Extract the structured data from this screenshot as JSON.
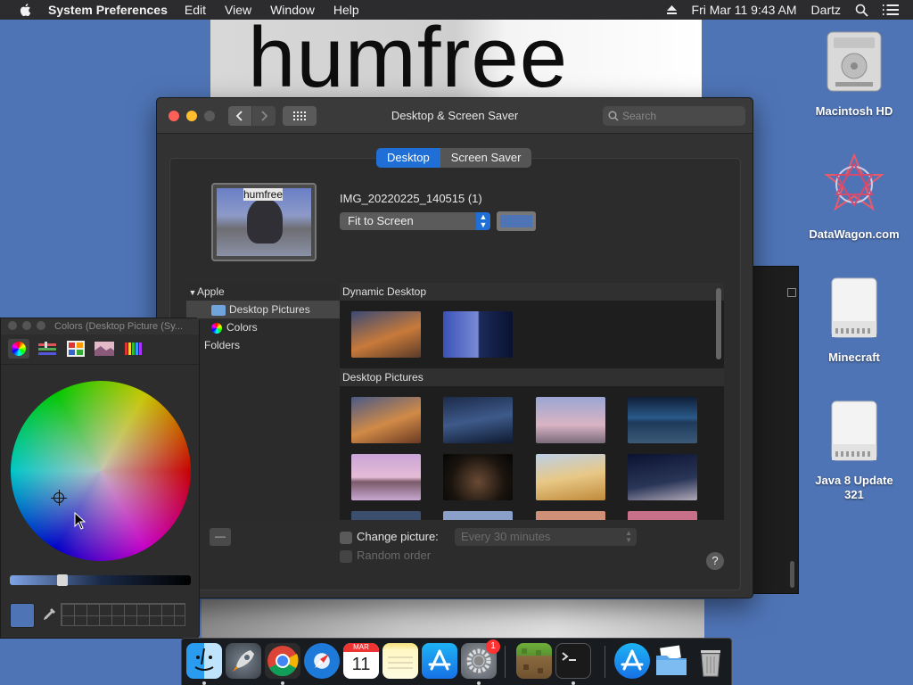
{
  "menubar": {
    "app_name": "System Preferences",
    "menus": [
      "Edit",
      "View",
      "Window",
      "Help"
    ],
    "datetime": "Fri Mar 11  9:43 AM",
    "user": "Dartz"
  },
  "wallpaper": {
    "text": "humfree"
  },
  "desktop_icons": [
    {
      "label": "Macintosh HD"
    },
    {
      "label": "DataWagon.com"
    },
    {
      "label": "Minecraft"
    },
    {
      "label": "Java 8 Update 321"
    }
  ],
  "prefs": {
    "title": "Desktop & Screen Saver",
    "search_placeholder": "Search",
    "tabs": [
      "Desktop",
      "Screen Saver"
    ],
    "active_tab": "Desktop",
    "preview_text": "humfree",
    "image_name": "IMG_20220225_140515 (1)",
    "fit_option": "Fit to Screen",
    "fill_color": "#4f74b6",
    "sidebar": {
      "group": "Apple",
      "items": [
        "Desktop Pictures",
        "Colors"
      ],
      "folders_label": "Folders"
    },
    "gallery": {
      "sections": [
        "Dynamic Desktop",
        "Desktop Pictures"
      ]
    },
    "change_picture_label": "Change picture:",
    "interval": "Every 30 minutes",
    "random_order_label": "Random order",
    "help": "?",
    "minus": "—"
  },
  "colors_panel": {
    "title": "Colors (Desktop Picture (Sy..."
  },
  "dock": {
    "apps": [
      "finder",
      "launchpad",
      "chrome",
      "safari",
      "calendar",
      "notes",
      "app-store",
      "system-preferences",
      "minecraft",
      "terminal",
      "app-store-folder",
      "folder",
      "trash"
    ],
    "calendar_month": "MAR",
    "calendar_day": "11",
    "badge": "1"
  }
}
